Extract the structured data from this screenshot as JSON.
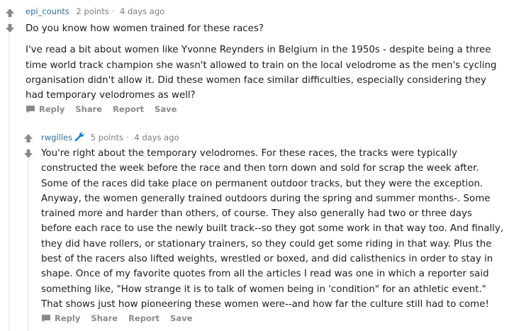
{
  "comments": [
    {
      "author": "epi_counts",
      "points": "2 points",
      "time": "4 days ago",
      "paragraphs": [
        "Do you know how women trained for these races?",
        "I've read a bit about women like Yvonne Reynders in Belgium in the 1950s - despite being a three time world track champion she wasn't allowed to train on the local velodrome as the men's cycling organisation didn't allow it. Did these women face similar difficulties, especially considering they had temporary velodromes as well?"
      ],
      "actions": [
        "Reply",
        "Share",
        "Report",
        "Save"
      ]
    },
    {
      "author": "rwgilles",
      "points": "5 points",
      "time": "4 days ago",
      "paragraphs": [
        "You're right about the temporary velodromes. For these races, the tracks were typically constructed the week before the race and then torn down and sold for scrap the week after. Some of the races did take place on permanent outdoor tracks, but they were the exception. Anyway, the women generally trained outdoors during the spring and summer months-. Some trained more and harder than others, of course. They also generally had two or three days before each race to use the newly built track--so they got some work in that way too. And finally, they did have rollers, or stationary trainers, so they could get some riding in that way. Plus the best of the racers also lifted weights, wrestled or boxed, and did calisthenics in order to stay in shape. Once of my favorite quotes from all the articles I read was one in which a reporter said something like, \"How strange it is to talk of women being in 'condition\" for an athletic event.\" That shows just how pioneering these women were--and how far the culture still had to come!"
      ],
      "actions": [
        "Reply",
        "Share",
        "Report",
        "Save"
      ]
    }
  ],
  "separator": "·",
  "colors": {
    "author": "#2d6fa3",
    "meta": "#7c7c7c",
    "icon": "#878a8c",
    "mod_badge": "#0079d3"
  },
  "icons": {
    "upvote": "upvote-arrow-icon",
    "downvote": "downvote-arrow-icon",
    "reply": "comment-bubble-icon",
    "moderator": "moderator-wrench-icon"
  }
}
